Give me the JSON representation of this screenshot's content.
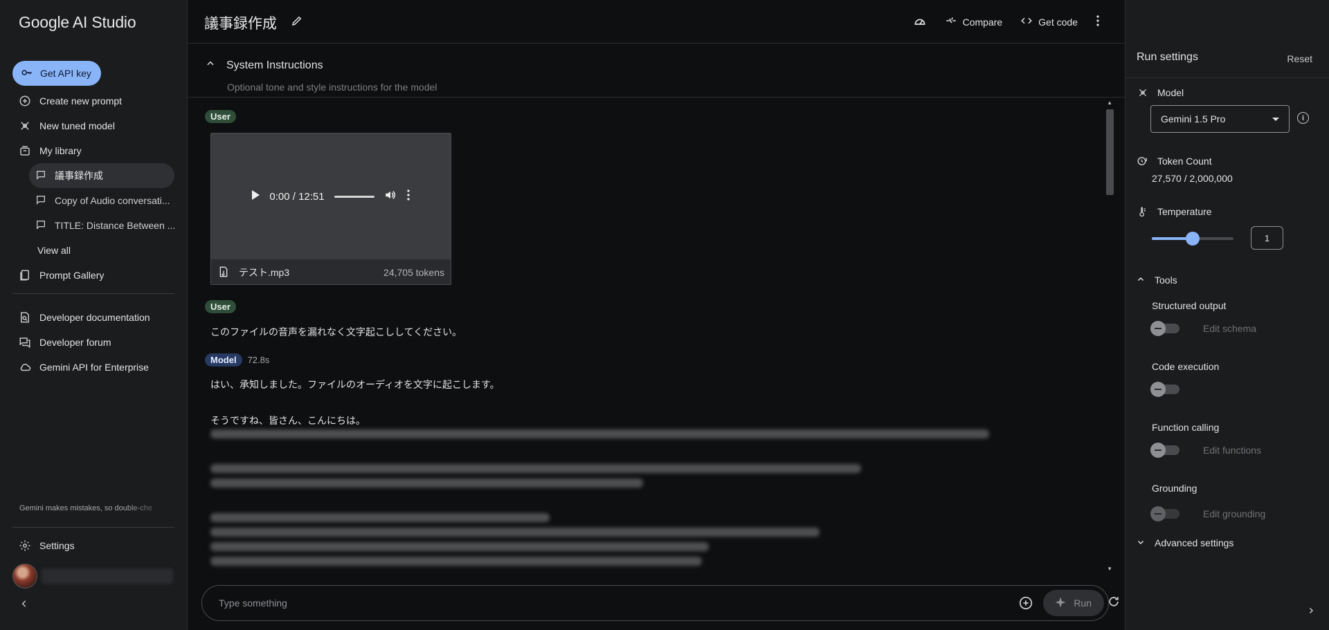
{
  "sidebar": {
    "brand": "Google AI Studio",
    "get_api_key": "Get API key",
    "nav": [
      {
        "label": "Create new prompt",
        "icon": "plus-circle-icon"
      },
      {
        "label": "New tuned model",
        "icon": "tune-icon"
      },
      {
        "label": "My library",
        "icon": "library-icon"
      }
    ],
    "library_items": [
      {
        "label": "議事録作成",
        "active": true
      },
      {
        "label": "Copy of Audio conversati..."
      },
      {
        "label": "TITLE: Distance Between ..."
      }
    ],
    "view_all": "View all",
    "prompt_gallery": "Prompt Gallery",
    "resources": [
      {
        "label": "Developer documentation",
        "icon": "doc-search-icon"
      },
      {
        "label": "Developer forum",
        "icon": "forum-icon"
      },
      {
        "label": "Gemini API for Enterprise",
        "icon": "cloud-icon"
      }
    ],
    "disclaimer": "Gemini makes mistakes, so double-che",
    "settings": "Settings"
  },
  "topbar": {
    "title": "議事録作成",
    "compare": "Compare",
    "get_code": "Get code"
  },
  "system_instructions": {
    "title": "System Instructions",
    "placeholder": "Optional tone and style instructions for the model"
  },
  "chat": {
    "user_badge": "User",
    "model_badge": "Model",
    "audio": {
      "time": "0:00 / 12:51",
      "filename": "テスト.mp3",
      "tokens": "24,705 tokens"
    },
    "user_message": "このファイルの音声を漏れなく文字起こししてください。",
    "model_time": "72.8s",
    "model_line1": "はい、承知しました。ファイルのオーディオを文字に起こします。",
    "model_line2": "そうですね、皆さん、こんにちは。"
  },
  "composer": {
    "placeholder": "Type something",
    "run": "Run"
  },
  "run_settings": {
    "title": "Run settings",
    "reset": "Reset",
    "model_label": "Model",
    "model_value": "Gemini 1.5 Pro",
    "token_label": "Token Count",
    "token_value": "27,570 / 2,000,000",
    "temperature_label": "Temperature",
    "temperature_value": "1",
    "temperature_fraction": 0.5,
    "tools_label": "Tools",
    "tools": [
      {
        "name": "Structured output",
        "link": "Edit schema"
      },
      {
        "name": "Code execution",
        "link": ""
      },
      {
        "name": "Function calling",
        "link": "Edit functions"
      },
      {
        "name": "Grounding",
        "link": "Edit grounding"
      }
    ],
    "advanced": "Advanced settings"
  }
}
